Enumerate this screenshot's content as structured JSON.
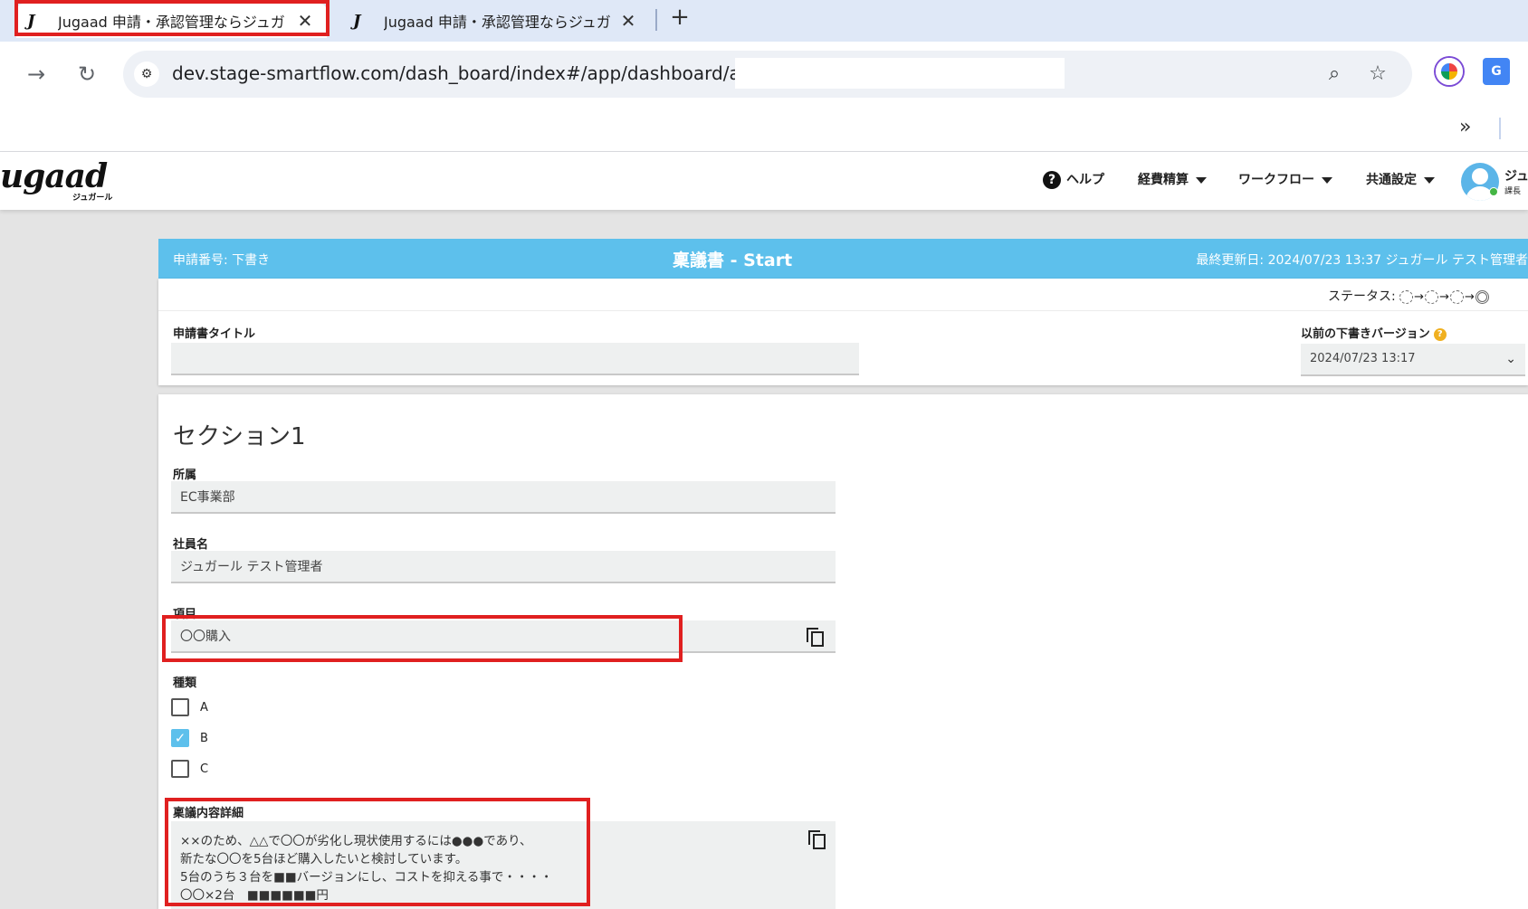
{
  "browser": {
    "tabs": [
      {
        "title": "Jugaad 申請・承認管理ならジュガ",
        "favicon": "J",
        "close": "✕"
      },
      {
        "title": "Jugaad 申請・承認管理ならジュガ",
        "favicon": "J",
        "close": "✕"
      }
    ],
    "new_tab": "+",
    "url": "dev.stage-smartflow.com/dash_board/index#/app/dashboard/app/",
    "more": "»"
  },
  "header": {
    "logo": "ugaad",
    "logo_sub": "ジュガール",
    "help": "ヘルプ",
    "nav": [
      "経費精算",
      "ワークフロー",
      "共通設定"
    ],
    "user_name": "ジュ",
    "user_role": "課長"
  },
  "form": {
    "app_number": "申請番号: 下書き",
    "form_title": "稟議書 - Start",
    "last_updated": "最終更新日: 2024/07/23 13:37  ジュガール テスト管理者",
    "status_label": "ステータス:",
    "title_label": "申請書タイトル",
    "title_value": "",
    "draft_version_label": "以前の下書きバージョン",
    "draft_version_value": "2024/07/23 13:17",
    "section_title": "セクション1",
    "fields": {
      "affiliation_label": "所属",
      "affiliation_value": "EC事業部",
      "employee_label": "社員名",
      "employee_value": "ジュガール テスト管理者",
      "item_label": "項目",
      "item_value": "〇〇購入",
      "type_label": "種類",
      "details_label": "稟議内容詳細"
    },
    "type_options": [
      {
        "label": "A",
        "checked": false
      },
      {
        "label": "B",
        "checked": true
      },
      {
        "label": "C",
        "checked": false
      }
    ],
    "details_lines": [
      "××のため、△△で〇〇が劣化し現状使用するには●●●であり、",
      "新たな〇〇を5台ほど購入したいと検討しています。",
      "5台のうち３台を■■バージョンにし、コストを抑える事で・・・・",
      "〇〇×2台　■■■■■■円"
    ]
  },
  "colors": {
    "accent": "#5dc0ec",
    "highlight": "#e02020",
    "checked": "#5dc0ec"
  }
}
